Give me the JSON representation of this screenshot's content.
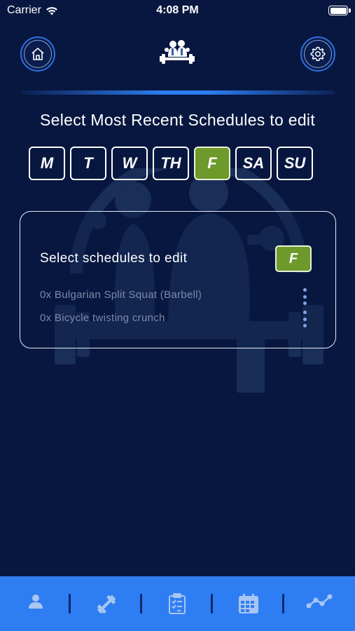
{
  "status_bar": {
    "carrier": "Carrier",
    "time": "4:08 PM",
    "wifi_icon": "wifi-icon",
    "battery_icon": "battery-icon"
  },
  "header": {
    "home_icon": "home-icon",
    "logo_icon": "fitness-logo-icon",
    "settings_icon": "gear-icon"
  },
  "page": {
    "title": "Select Most Recent Schedules to edit"
  },
  "days": [
    {
      "label": "M",
      "selected": false
    },
    {
      "label": "T",
      "selected": false
    },
    {
      "label": "W",
      "selected": false
    },
    {
      "label": "TH",
      "selected": false
    },
    {
      "label": "F",
      "selected": true
    },
    {
      "label": "SA",
      "selected": false
    },
    {
      "label": "SU",
      "selected": false
    }
  ],
  "card": {
    "title": "Select schedules to edit",
    "day_badge": "F",
    "exercises": [
      {
        "text": "0x Bulgarian Split Squat (Barbell)"
      },
      {
        "text": "0x Bicycle twisting crunch"
      }
    ]
  },
  "tab_bar": {
    "tabs": [
      {
        "icon": "profile-icon"
      },
      {
        "icon": "dumbbell-icon"
      },
      {
        "icon": "checklist-icon"
      },
      {
        "icon": "calendar-icon"
      },
      {
        "icon": "progress-chart-icon"
      }
    ]
  },
  "colors": {
    "background": "#08173f",
    "accent_blue": "#2f7df2",
    "selected_green": "#6d9a2a",
    "muted_text": "#7d8aa8"
  }
}
